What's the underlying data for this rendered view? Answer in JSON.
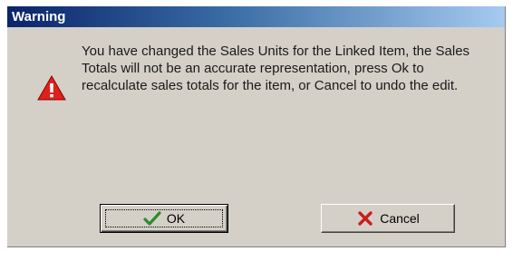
{
  "dialog": {
    "title": "Warning",
    "message": "You have changed the Sales Units for the Linked Item, the Sales Totals will not be an accurate representation, press Ok to recalculate sales totals for the item, or Cancel to undo the edit.",
    "icon": "warning-icon"
  },
  "buttons": {
    "ok_label": "OK",
    "ok_icon": "checkmark-icon",
    "cancel_label": "Cancel",
    "cancel_icon": "red-x-icon"
  },
  "colors": {
    "title_bar_start": "#0a246a",
    "title_bar_end": "#a6caf0",
    "dialog_face": "#d4d0c8",
    "warning_red": "#e0201a",
    "check_green": "#2e8b2e"
  }
}
